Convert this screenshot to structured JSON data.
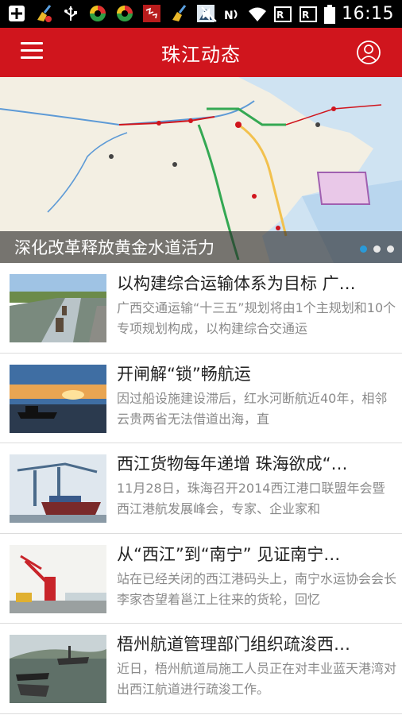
{
  "status_bar": {
    "time": "16:15",
    "left_icons": [
      "add-icon",
      "broom-icon",
      "usb-icon",
      "sync-icon",
      "sync-icon",
      "app-icon",
      "broom-icon",
      "app-icon"
    ],
    "right_icons": [
      "mute-icon",
      "nfc-icon",
      "wifi-icon",
      "sim1-icon",
      "sim2-icon",
      "battery-icon"
    ]
  },
  "app_bar": {
    "title": "珠江动态",
    "color": "#d0151d"
  },
  "banner": {
    "caption": "深化改革释放黄金水道活力",
    "page_count": 3,
    "active_page": 1
  },
  "news": [
    {
      "title": "以构建综合运输体系为目标 广…",
      "desc": "广西交通运输“十三五”规划将由1个主规划和10个专项规划构成，以构建综合交通运"
    },
    {
      "title": "开闸解“锁”畅航运",
      "desc": "因过船设施建设滞后，红水河断航近40年，相邻云贵两省无法借道出海，直"
    },
    {
      "title": "西江货物每年递增 珠海欲成“…",
      "desc": "11月28日，珠海召开2014西江港口联盟年会暨西江港航发展峰会，专家、企业家和"
    },
    {
      "title": "从“西江”到“南宁” 见证南宁…",
      "desc": "站在已经关闭的西江港码头上，南宁水运协会会长李家杏望着邕江上往来的货轮，回忆"
    },
    {
      "title": "梧州航道管理部门组织疏浚西…",
      "desc": "近日，梧州航道局施工人员正在对丰业蓝天港湾对出西江航道进行疏浚工作。"
    }
  ]
}
